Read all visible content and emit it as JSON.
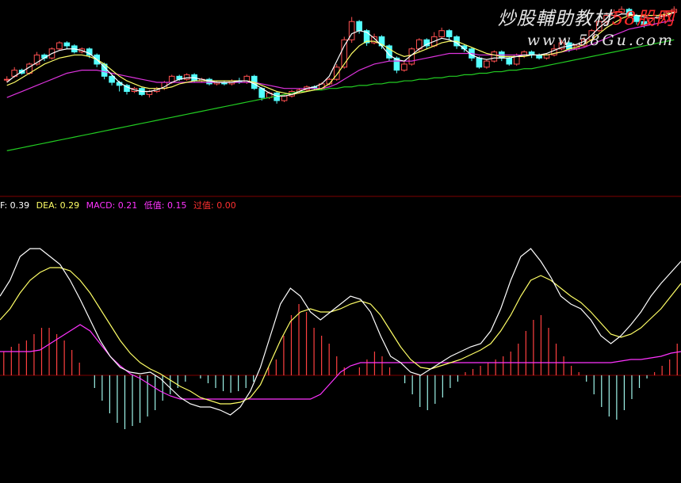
{
  "watermark": {
    "title_main": "炒股輔助教材",
    "title_accent": "58股网",
    "url": "www.58Gu.com"
  },
  "colors": {
    "background": "#000000",
    "separator": "#800000",
    "up_candle": "#ff5050",
    "down_candle": "#54ffff",
    "ma_short": "#ffffff",
    "ma_mid": "#ffff66",
    "ma_long": "#dd33dd",
    "ma_longest": "#22cc22",
    "dif": "#ffffff",
    "dea": "#ffff66",
    "low_value": "#ff33ff",
    "macd_pos": "#ff4040",
    "macd_neg": "#9ff5ea",
    "legend_dif": "#ffffff",
    "legend_dea": "#ffff66",
    "legend_macd": "#ff33ff",
    "legend_low": "#ff33ff",
    "legend_cross": "#ff3030"
  },
  "legend": [
    {
      "key": "dif",
      "text": "F: 0.39"
    },
    {
      "key": "dea",
      "text": "DEA: 0.29"
    },
    {
      "key": "macd",
      "text": "MACD: 0.21"
    },
    {
      "key": "low",
      "text": "低值: 0.15"
    },
    {
      "key": "cross",
      "text": "过值: 0.00"
    }
  ],
  "chart_data": [
    {
      "type": "candlestick",
      "panel": "price",
      "grid": false,
      "ylim": [
        0,
        100
      ],
      "candles": [
        [
          52,
          52,
          54,
          50
        ],
        [
          54,
          58,
          60,
          53
        ],
        [
          58,
          56,
          59,
          55
        ],
        [
          56,
          62,
          63,
          55
        ],
        [
          62,
          68,
          70,
          61
        ],
        [
          68,
          66,
          69,
          64
        ],
        [
          66,
          72,
          73,
          65
        ],
        [
          72,
          76,
          77,
          71
        ],
        [
          76,
          74,
          77,
          72
        ],
        [
          74,
          70,
          75,
          69
        ],
        [
          70,
          72,
          73,
          69
        ],
        [
          72,
          68,
          73,
          66
        ],
        [
          68,
          62,
          69,
          60
        ],
        [
          62,
          54,
          63,
          52
        ],
        [
          54,
          50,
          55,
          48
        ],
        [
          50,
          48,
          51,
          44
        ],
        [
          48,
          44,
          49,
          42
        ],
        [
          44,
          46,
          47,
          43
        ],
        [
          46,
          42,
          47,
          41
        ],
        [
          42,
          44,
          45,
          40
        ],
        [
          44,
          46,
          47,
          43
        ],
        [
          46,
          50,
          51,
          45
        ],
        [
          50,
          54,
          55,
          49
        ],
        [
          54,
          52,
          55,
          51
        ],
        [
          52,
          55,
          56,
          51
        ],
        [
          55,
          51,
          56,
          50
        ],
        [
          51,
          52,
          53,
          50
        ],
        [
          52,
          49,
          53,
          48
        ],
        [
          49,
          50,
          51,
          48
        ],
        [
          50,
          49,
          51,
          48
        ],
        [
          49,
          51,
          52,
          48
        ],
        [
          51,
          50,
          53,
          49
        ],
        [
          50,
          54,
          55,
          49
        ],
        [
          54,
          46,
          55,
          45
        ],
        [
          46,
          40,
          47,
          38
        ],
        [
          40,
          43,
          44,
          39
        ],
        [
          43,
          38,
          44,
          36
        ],
        [
          38,
          41,
          42,
          37
        ],
        [
          41,
          44,
          45,
          40
        ],
        [
          44,
          45,
          46,
          43
        ],
        [
          45,
          47,
          48,
          44
        ],
        [
          47,
          46,
          48,
          45
        ],
        [
          46,
          49,
          50,
          45
        ],
        [
          49,
          52,
          53,
          48
        ],
        [
          52,
          60,
          62,
          51
        ],
        [
          60,
          78,
          80,
          59
        ],
        [
          78,
          90,
          93,
          76
        ],
        [
          90,
          84,
          91,
          82
        ],
        [
          84,
          76,
          85,
          74
        ],
        [
          76,
          80,
          82,
          75
        ],
        [
          80,
          74,
          81,
          72
        ],
        [
          74,
          66,
          75,
          64
        ],
        [
          66,
          58,
          67,
          56
        ],
        [
          58,
          62,
          64,
          57
        ],
        [
          62,
          72,
          73,
          61
        ],
        [
          72,
          78,
          79,
          70
        ],
        [
          78,
          74,
          79,
          72
        ],
        [
          74,
          80,
          83,
          73
        ],
        [
          80,
          84,
          86,
          79
        ],
        [
          84,
          80,
          85,
          78
        ],
        [
          80,
          74,
          81,
          72
        ],
        [
          74,
          72,
          75,
          70
        ],
        [
          72,
          66,
          73,
          64
        ],
        [
          66,
          60,
          67,
          59
        ],
        [
          60,
          64,
          65,
          59
        ],
        [
          64,
          70,
          71,
          63
        ],
        [
          70,
          66,
          71,
          64
        ],
        [
          66,
          62,
          67,
          61
        ],
        [
          62,
          68,
          69,
          61
        ],
        [
          68,
          70,
          71,
          66
        ],
        [
          70,
          68,
          71,
          66
        ],
        [
          68,
          66,
          69,
          65
        ],
        [
          66,
          68,
          69,
          65
        ],
        [
          68,
          72,
          75,
          67
        ],
        [
          72,
          76,
          78,
          71
        ],
        [
          76,
          72,
          77,
          70
        ],
        [
          72,
          74,
          75,
          71
        ],
        [
          74,
          78,
          80,
          73
        ],
        [
          78,
          84,
          85,
          77
        ],
        [
          84,
          90,
          91,
          83
        ],
        [
          90,
          94,
          96,
          88
        ],
        [
          94,
          96,
          98,
          92
        ],
        [
          96,
          98,
          100,
          95
        ],
        [
          98,
          94,
          99,
          93
        ],
        [
          94,
          90,
          95,
          88
        ],
        [
          90,
          88,
          91,
          86
        ],
        [
          88,
          92,
          93,
          87
        ],
        [
          92,
          94,
          95,
          90
        ],
        [
          94,
          96,
          97,
          93
        ],
        [
          96,
          98,
          100,
          95
        ]
      ],
      "ma_short": [
        50,
        54,
        57,
        60,
        63,
        66,
        69,
        71,
        72,
        72,
        71,
        69,
        65,
        60,
        55,
        50,
        47,
        45,
        44,
        44,
        45,
        47,
        50,
        52,
        53,
        53,
        52,
        51,
        50,
        50,
        50,
        51,
        51,
        49,
        46,
        43,
        41,
        41,
        42,
        44,
        46,
        47,
        49,
        54,
        64,
        74,
        82,
        84,
        83,
        79,
        74,
        68,
        65,
        64,
        68,
        72,
        75,
        77,
        79,
        78,
        76,
        72,
        68,
        66,
        65,
        66,
        66,
        66,
        67,
        68,
        68,
        68,
        69,
        71,
        73,
        74,
        75,
        77,
        81,
        86,
        90,
        93,
        95,
        95,
        94,
        93,
        92,
        93,
        94,
        96
      ],
      "ma_mid": [
        48,
        50,
        53,
        56,
        59,
        62,
        64,
        66,
        67,
        68,
        68,
        67,
        65,
        62,
        58,
        54,
        51,
        49,
        47,
        46,
        46,
        46,
        47,
        49,
        50,
        51,
        51,
        51,
        51,
        51,
        51,
        51,
        51,
        50,
        48,
        46,
        44,
        43,
        42,
        43,
        44,
        45,
        46,
        49,
        55,
        62,
        69,
        74,
        77,
        77,
        75,
        72,
        69,
        67,
        68,
        70,
        72,
        74,
        76,
        77,
        77,
        75,
        73,
        71,
        69,
        68,
        67,
        67,
        67,
        67,
        68,
        68,
        68,
        69,
        70,
        72,
        73,
        75,
        78,
        82,
        86,
        89,
        92,
        94,
        94,
        94,
        94,
        94,
        95,
        96
      ],
      "ma_long": [
        40,
        42,
        44,
        46,
        48,
        50,
        52,
        54,
        56,
        57,
        58,
        58,
        58,
        57,
        56,
        55,
        54,
        53,
        52,
        51,
        50,
        50,
        50,
        50,
        50,
        50,
        50,
        50,
        50,
        50,
        50,
        50,
        50,
        50,
        49,
        48,
        47,
        46,
        46,
        46,
        46,
        46,
        46,
        47,
        49,
        52,
        55,
        58,
        60,
        62,
        63,
        64,
        64,
        64,
        64,
        65,
        66,
        67,
        68,
        69,
        69,
        69,
        69,
        68,
        68,
        68,
        68,
        68,
        68,
        68,
        68,
        68,
        68,
        69,
        70,
        71,
        72,
        73,
        75,
        77,
        79,
        81,
        83,
        85,
        86,
        87,
        88,
        89,
        90,
        91
      ],
      "ma_longest": [
        5,
        6,
        7,
        8,
        9,
        10,
        11,
        12,
        13,
        14,
        15,
        16,
        17,
        18,
        19,
        20,
        21,
        22,
        23,
        24,
        25,
        26,
        27,
        28,
        29,
        30,
        31,
        32,
        33,
        34,
        35,
        36,
        37,
        38,
        39,
        40,
        41,
        42,
        43,
        44,
        44,
        45,
        45,
        46,
        46,
        47,
        47,
        48,
        48,
        49,
        49,
        50,
        50,
        51,
        51,
        52,
        52,
        53,
        53,
        54,
        54,
        55,
        55,
        56,
        56,
        57,
        57,
        58,
        58,
        59,
        59,
        60,
        61,
        62,
        63,
        64,
        65,
        66,
        67,
        68,
        69,
        70,
        71,
        72,
        73,
        74,
        75,
        76,
        77,
        78
      ]
    },
    {
      "type": "bar",
      "panel": "macd",
      "grid": false,
      "ylim": [
        -1,
        1
      ],
      "macd": [
        0.15,
        0.18,
        0.2,
        0.22,
        0.26,
        0.3,
        0.3,
        0.26,
        0.22,
        0.16,
        0.08,
        0,
        -0.08,
        -0.16,
        -0.24,
        -0.3,
        -0.34,
        -0.32,
        -0.3,
        -0.26,
        -0.22,
        -0.16,
        -0.12,
        -0.08,
        -0.04,
        0,
        -0.02,
        -0.05,
        -0.08,
        -0.1,
        -0.11,
        -0.1,
        -0.08,
        -0.04,
        0,
        0.05,
        0.1,
        0.25,
        0.38,
        0.45,
        0.4,
        0.3,
        0.25,
        0.2,
        0.12,
        0.05,
        0,
        0.05,
        0.1,
        0.15,
        0.12,
        0.05,
        0,
        -0.05,
        -0.12,
        -0.2,
        -0.22,
        -0.18,
        -0.14,
        -0.08,
        -0.04,
        0.02,
        0.04,
        0.06,
        0.08,
        0.1,
        0.12,
        0.15,
        0.2,
        0.28,
        0.35,
        0.38,
        0.3,
        0.2,
        0.12,
        0.06,
        0.02,
        -0.04,
        -0.12,
        -0.2,
        -0.26,
        -0.28,
        -0.22,
        -0.15,
        -0.08,
        -0.02,
        0.02,
        0.06,
        0.1,
        0.2
      ],
      "dif": [
        0.5,
        0.6,
        0.75,
        0.8,
        0.8,
        0.75,
        0.7,
        0.6,
        0.48,
        0.35,
        0.22,
        0.12,
        0.05,
        0.02,
        0.01,
        0.02,
        -0.02,
        -0.08,
        -0.14,
        -0.18,
        -0.2,
        -0.2,
        -0.22,
        -0.25,
        -0.2,
        -0.1,
        0.05,
        0.25,
        0.45,
        0.55,
        0.5,
        0.4,
        0.35,
        0.4,
        0.45,
        0.5,
        0.48,
        0.4,
        0.25,
        0.12,
        0.08,
        0.02,
        0,
        0.04,
        0.08,
        0.12,
        0.15,
        0.18,
        0.2,
        0.28,
        0.42,
        0.6,
        0.75,
        0.8,
        0.72,
        0.62,
        0.5,
        0.45,
        0.42,
        0.35,
        0.25,
        0.2,
        0.25,
        0.32,
        0.4,
        0.5,
        0.58,
        0.65,
        0.72
      ],
      "dea": [
        0.35,
        0.42,
        0.52,
        0.6,
        0.65,
        0.68,
        0.68,
        0.66,
        0.6,
        0.52,
        0.42,
        0.32,
        0.22,
        0.14,
        0.08,
        0.04,
        0.01,
        -0.03,
        -0.07,
        -0.1,
        -0.14,
        -0.16,
        -0.18,
        -0.18,
        -0.17,
        -0.14,
        -0.06,
        0.08,
        0.22,
        0.34,
        0.4,
        0.42,
        0.4,
        0.4,
        0.42,
        0.45,
        0.47,
        0.45,
        0.38,
        0.28,
        0.18,
        0.1,
        0.05,
        0.04,
        0.06,
        0.08,
        0.1,
        0.13,
        0.16,
        0.2,
        0.28,
        0.38,
        0.5,
        0.6,
        0.63,
        0.6,
        0.55,
        0.5,
        0.46,
        0.4,
        0.33,
        0.26,
        0.24,
        0.26,
        0.3,
        0.36,
        0.42,
        0.5,
        0.58
      ],
      "low_value": [
        0.15,
        0.15,
        0.15,
        0.15,
        0.16,
        0.2,
        0.24,
        0.28,
        0.32,
        0.28,
        0.2,
        0.12,
        0.06,
        0.01,
        -0.02,
        -0.06,
        -0.1,
        -0.13,
        -0.15,
        -0.15,
        -0.15,
        -0.15,
        -0.15,
        -0.15,
        -0.15,
        -0.15,
        -0.15,
        -0.15,
        -0.15,
        -0.15,
        -0.15,
        -0.15,
        -0.12,
        -0.05,
        0.02,
        0.06,
        0.08,
        0.08,
        0.08,
        0.08,
        0.08,
        0.08,
        0.08,
        0.08,
        0.08,
        0.08,
        0.08,
        0.08,
        0.08,
        0.08,
        0.08,
        0.08,
        0.08,
        0.08,
        0.08,
        0.08,
        0.08,
        0.08,
        0.08,
        0.08,
        0.08,
        0.08,
        0.09,
        0.1,
        0.1,
        0.11,
        0.12,
        0.14,
        0.15
      ]
    }
  ]
}
